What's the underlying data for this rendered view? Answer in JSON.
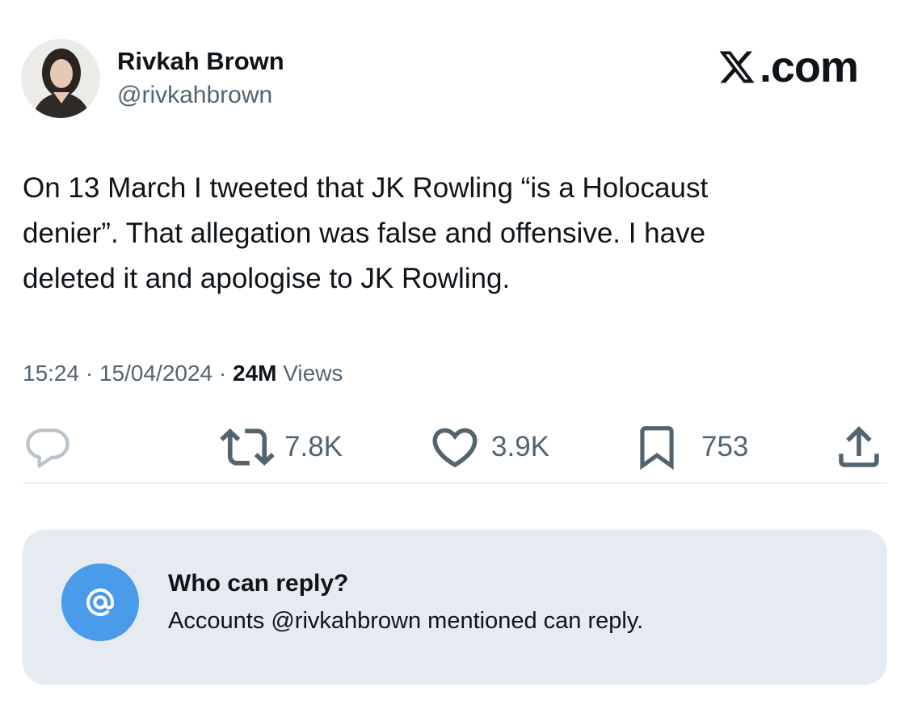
{
  "author": {
    "display_name": "Rivkah Brown",
    "handle": "@rivkahbrown"
  },
  "brand": {
    "label": ".com",
    "icon": "x-logo-icon"
  },
  "tweet": {
    "lines": [
      "On 13 March I tweeted that JK Rowling “is a Holocaust",
      "denier”. That allegation was false and offensive. I have",
      "deleted it and apologise to JK Rowling."
    ]
  },
  "meta": {
    "time": "15:24",
    "separator": " · ",
    "date": "15/04/2024",
    "views_count": "24M",
    "views_label": " Views"
  },
  "actions": {
    "reply": {
      "icon": "reply-icon",
      "count": ""
    },
    "repost": {
      "icon": "repost-icon",
      "count": "7.8K"
    },
    "like": {
      "icon": "heart-icon",
      "count": "3.9K"
    },
    "bookmark": {
      "icon": "bookmark-icon",
      "count": "753"
    },
    "share": {
      "icon": "share-icon"
    }
  },
  "who_can_reply": {
    "icon": "at-sign-icon",
    "icon_glyph": "@",
    "title": "Who can reply?",
    "description": "Accounts @rivkahbrown mentioned can reply."
  },
  "colors": {
    "text_primary": "#0f1419",
    "text_secondary": "#536471",
    "accent_blue": "#4a9bea",
    "reply_box_bg": "#e6ebf1"
  }
}
